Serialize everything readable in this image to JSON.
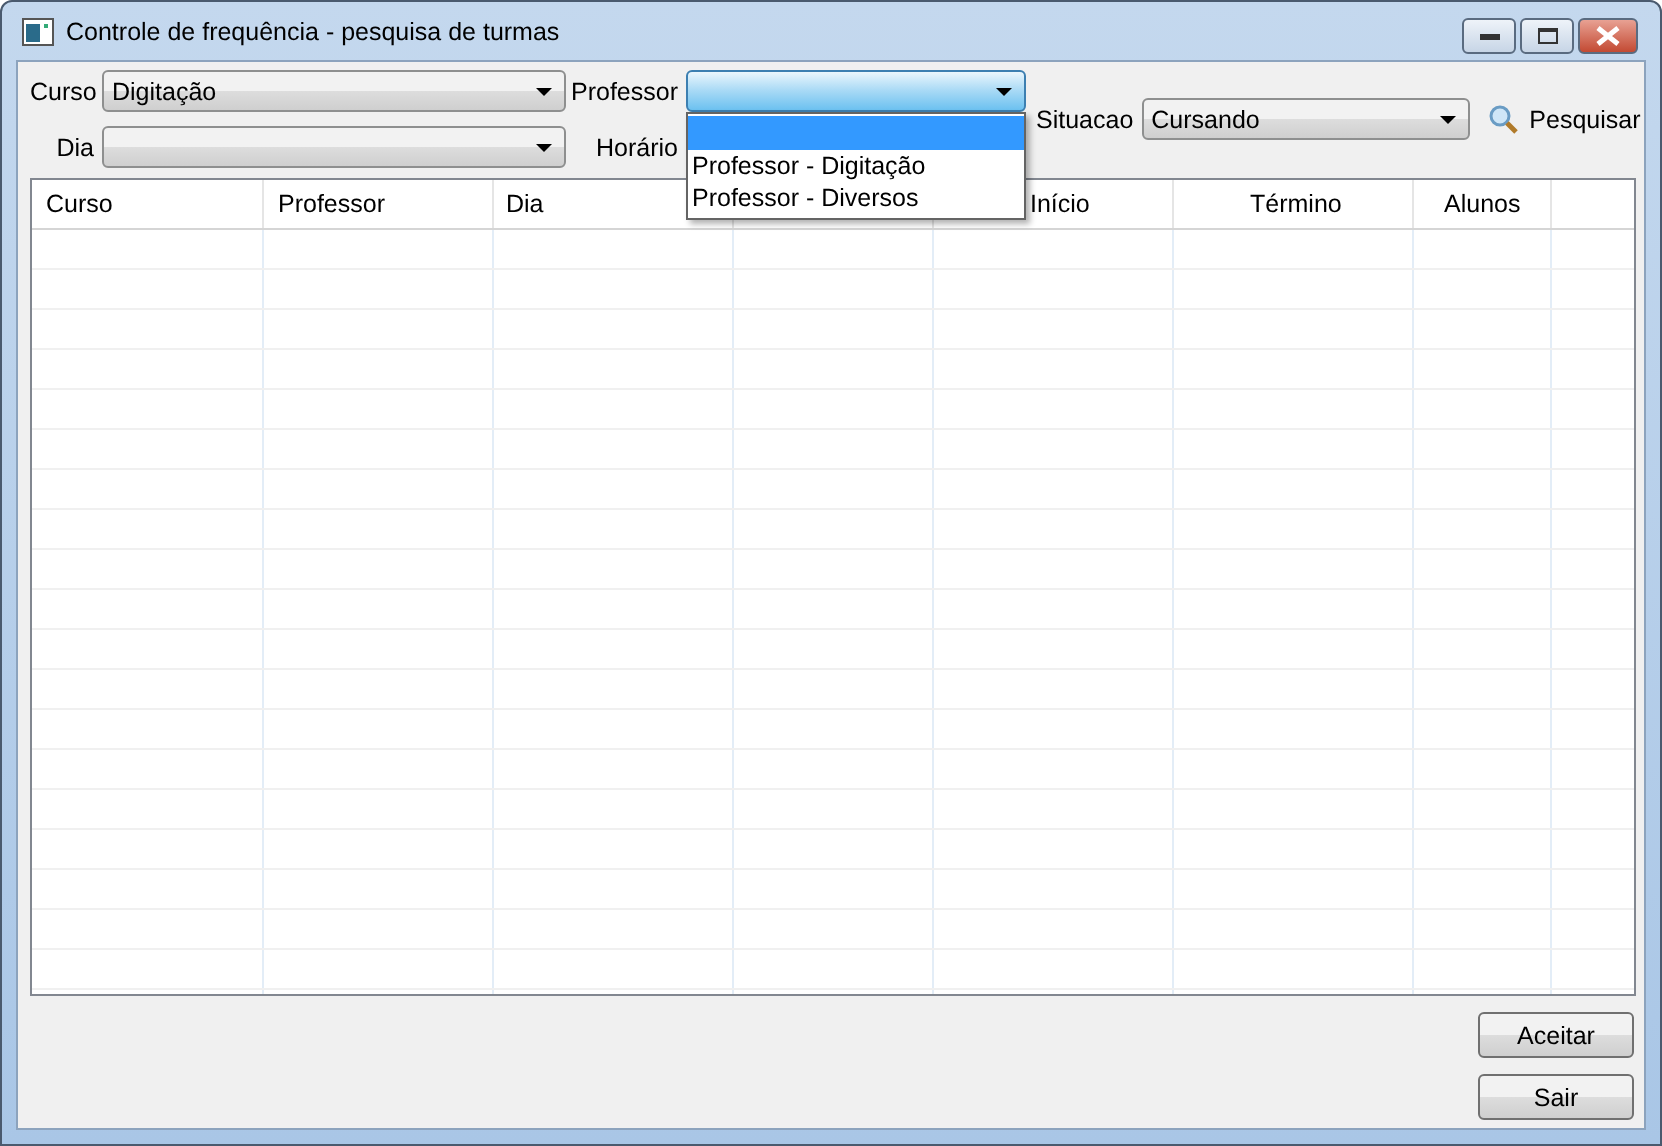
{
  "window": {
    "title": "Controle de frequência - pesquisa de turmas"
  },
  "filters": {
    "curso": {
      "label": "Curso",
      "value": "Digitação"
    },
    "professor": {
      "label": "Professor",
      "expanded": true,
      "options": [
        {
          "selected": true
        },
        {
          "label": "Professor - Digitação",
          "selected": false
        },
        {
          "label": "Professor - Diversos",
          "selected": false
        }
      ]
    },
    "dia": {
      "label": "Dia"
    },
    "horario": {
      "label": "Horário"
    },
    "situacao": {
      "label": "Situacao",
      "value": "Cursando"
    },
    "search_button": {
      "label": "Pesquisar"
    }
  },
  "table": {
    "columns": [
      {
        "label": "Curso"
      },
      {
        "label": "Professor"
      },
      {
        "label": "Dia"
      },
      {},
      {
        "label": "Início"
      },
      {
        "label": "Término"
      },
      {
        "label": "Alunos"
      }
    ]
  },
  "buttons": [
    "Aceitar",
    "Sair"
  ]
}
